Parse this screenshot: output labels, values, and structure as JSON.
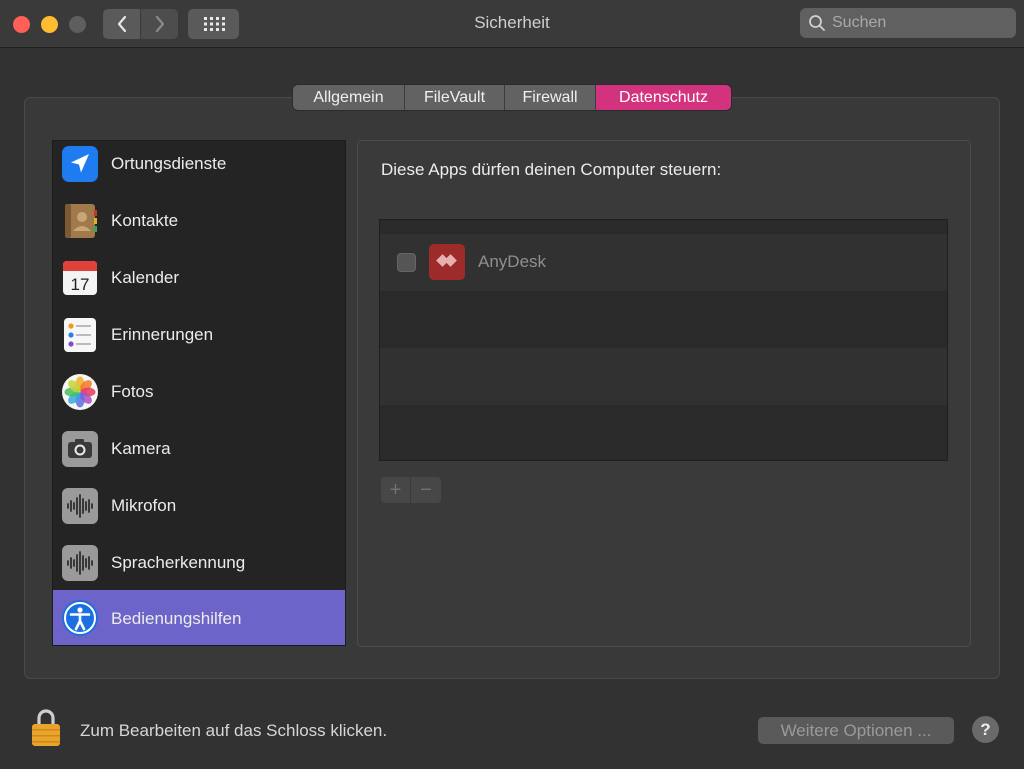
{
  "window": {
    "title": "Sicherheit"
  },
  "search": {
    "placeholder": "Suchen"
  },
  "tabs": [
    {
      "label": "Allgemein",
      "active": false
    },
    {
      "label": "FileVault",
      "active": false
    },
    {
      "label": "Firewall",
      "active": false
    },
    {
      "label": "Datenschutz",
      "active": true
    }
  ],
  "sidebar": {
    "items": [
      {
        "label": "Ortungsdienste",
        "icon": "location-arrow-icon"
      },
      {
        "label": "Kontakte",
        "icon": "contacts-book-icon"
      },
      {
        "label": "Kalender",
        "icon": "calendar-icon",
        "icon_text": "17"
      },
      {
        "label": "Erinnerungen",
        "icon": "reminders-list-icon"
      },
      {
        "label": "Fotos",
        "icon": "photos-flower-icon"
      },
      {
        "label": "Kamera",
        "icon": "camera-icon"
      },
      {
        "label": "Mikrofon",
        "icon": "microphone-waveform-icon"
      },
      {
        "label": "Spracherkennung",
        "icon": "speech-waveform-icon"
      },
      {
        "label": "Bedienungshilfen",
        "icon": "accessibility-icon",
        "selected": true
      }
    ]
  },
  "content": {
    "heading": "Diese Apps dürfen deinen Computer steuern:",
    "apps": [
      {
        "name": "AnyDesk",
        "checked": false,
        "icon": "anydesk-icon"
      }
    ],
    "add_label": "+",
    "remove_label": "−"
  },
  "footer": {
    "lock_text": "Zum Bearbeiten auf das Schloss klicken.",
    "more_options": "Weitere Optionen ...",
    "help": "?"
  },
  "colors": {
    "accent_tab": "#d3337e",
    "selected_row": "#6c64c8",
    "anydesk": "#9d2b2a"
  }
}
